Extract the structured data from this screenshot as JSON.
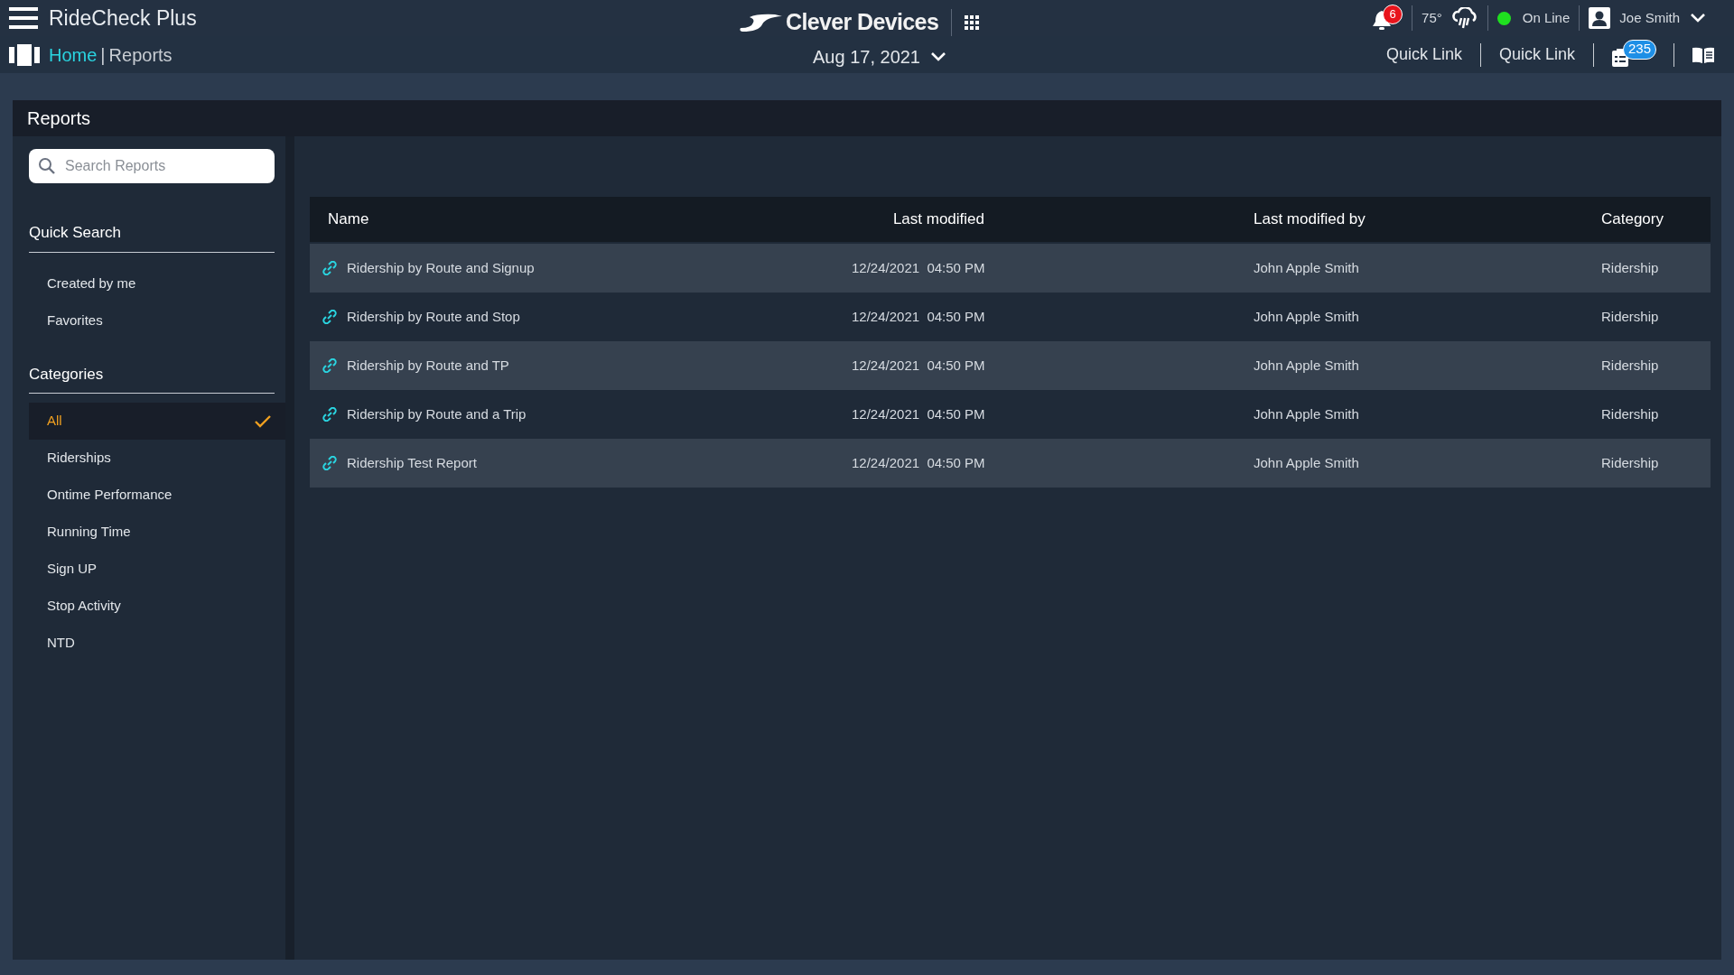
{
  "app": {
    "title": "RideCheck Plus",
    "logo_text": "Clever Devices"
  },
  "status": {
    "notification_count": "6",
    "temperature": "75°",
    "connection": "On Line",
    "online": true,
    "user": "Joe Smith"
  },
  "breadcrumb": [
    {
      "label": "Home",
      "kind": "link"
    },
    {
      "label": "|",
      "kind": "separator"
    },
    {
      "label": "Reports",
      "kind": "current"
    }
  ],
  "date": "Aug 17, 2021",
  "quick_links": [
    {
      "label": "Quick Link"
    },
    {
      "label": "Quick Link"
    }
  ],
  "task_count": "235",
  "panel": {
    "title": "Reports"
  },
  "search": {
    "placeholder": "Search Reports"
  },
  "quick_search": {
    "title": "Quick Search",
    "items": [
      "Created by me",
      "Favorites"
    ]
  },
  "categories": {
    "title": "Categories",
    "items": [
      {
        "label": "All",
        "selected": true
      },
      {
        "label": "Riderships",
        "selected": false
      },
      {
        "label": "Ontime Performance",
        "selected": false
      },
      {
        "label": "Running Time",
        "selected": false
      },
      {
        "label": "Sign UP",
        "selected": false
      },
      {
        "label": "Stop Activity",
        "selected": false
      },
      {
        "label": "NTD",
        "selected": false
      }
    ]
  },
  "table": {
    "columns": [
      "Name",
      "Last modified",
      "Last modified by",
      "Category"
    ],
    "rows": [
      {
        "name": "Ridership by Route and Signup",
        "modified": "12/24/2021  04:50 PM",
        "by": "John Apple Smith",
        "category": "Ridership"
      },
      {
        "name": "Ridership by Route and Stop",
        "modified": "12/24/2021  04:50 PM",
        "by": "John Apple Smith",
        "category": "Ridership"
      },
      {
        "name": "Ridership by Route and TP",
        "modified": "12/24/2021  04:50 PM",
        "by": "John Apple Smith",
        "category": "Ridership"
      },
      {
        "name": "Ridership by Route and a Trip",
        "modified": "12/24/2021  04:50 PM",
        "by": "John Apple Smith",
        "category": "Ridership"
      },
      {
        "name": "Ridership Test Report",
        "modified": "12/24/2021  04:50 PM",
        "by": "John Apple Smith",
        "category": "Ridership"
      }
    ]
  }
}
